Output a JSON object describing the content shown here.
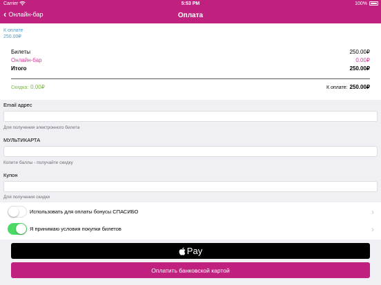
{
  "status_bar": {
    "carrier": "Carrier",
    "time": "5:53 PM",
    "battery": "100%"
  },
  "nav": {
    "back_label": "Онлайн-бар",
    "title": "Оплата"
  },
  "summary": {
    "topay_label": "К оплате",
    "topay_value": "250.00₽",
    "rows": [
      {
        "label": "Билеты",
        "value": "250.00₽"
      },
      {
        "label": "Онлайн-бар",
        "value": "0.00₽"
      },
      {
        "label": "Итого",
        "value": "250.00₽"
      }
    ],
    "discount_label": "Скидка:",
    "discount_value": "0.00₽",
    "total_label": "К оплате:",
    "total_value": "250.00₽"
  },
  "form": {
    "email": {
      "label": "Email адрес",
      "value": "",
      "hint": "Для получения электронного билета"
    },
    "multicard": {
      "label": "МУЛЬТИКАРТА",
      "value": "",
      "hint": "Копите баллы - получайте скидку"
    },
    "coupon": {
      "label": "Купон",
      "value": "",
      "hint": "Для получения скидки"
    }
  },
  "toggles": [
    {
      "label": "Использовать для оплаты бонусы СПАСИБО",
      "on": false
    },
    {
      "label": "Я принимаю условия покупки билетов",
      "on": true
    }
  ],
  "buttons": {
    "apple_pay": "Pay",
    "card_pay": "Оплатить банковской картой"
  },
  "colors": {
    "accent": "#c0217f",
    "link": "#3d9fd8",
    "discount": "#7bb540",
    "switch_on": "#4cd964"
  }
}
